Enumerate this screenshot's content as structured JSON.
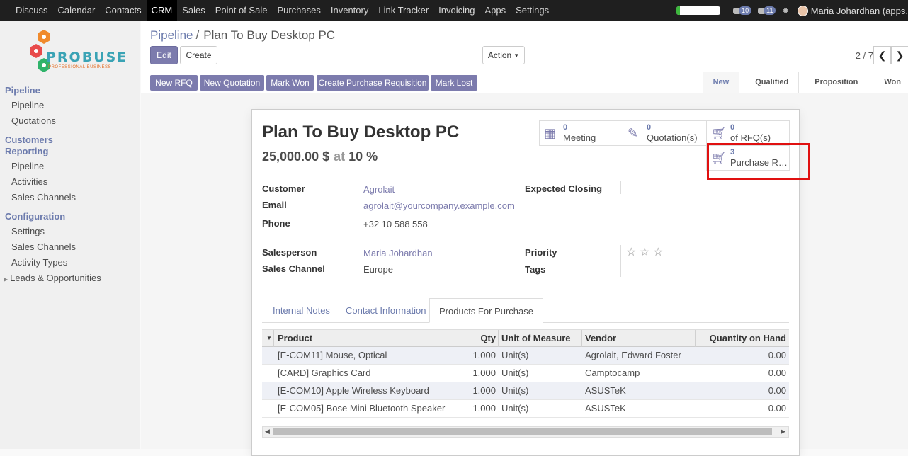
{
  "topbar": {
    "menu": [
      "Discuss",
      "Calendar",
      "Contacts",
      "CRM",
      "Sales",
      "Point of Sale",
      "Purchases",
      "Inventory",
      "Link Tracker",
      "Invoicing",
      "Apps",
      "Settings"
    ],
    "active": "CRM",
    "progress": 0.08,
    "messages_count": "10",
    "chat_count": "11",
    "username": "Maria Johardhan (apps."
  },
  "logo": {
    "brand": "PROBUSE",
    "tagline": "PROFESSIONAL BUSINESS"
  },
  "sidebar": {
    "pipeline_header": "Pipeline",
    "pipeline_items": [
      "Pipeline",
      "Quotations"
    ],
    "customers_header": "Customers",
    "reporting_header": "Reporting",
    "reporting_items": [
      "Pipeline",
      "Activities",
      "Sales Channels"
    ],
    "config_header": "Configuration",
    "config_items": [
      "Settings",
      "Sales Channels",
      "Activity Types"
    ],
    "leads_item": "Leads & Opportunities"
  },
  "breadcrumb": {
    "parent": "Pipeline",
    "separator": "/",
    "current": "Plan To Buy Desktop PC"
  },
  "buttons": {
    "edit": "Edit",
    "create": "Create",
    "action": "Action"
  },
  "pager": {
    "value": "2 / 7"
  },
  "status_buttons": [
    "New RFQ",
    "New Quotation",
    "Mark Won",
    "Create Purchase Requisition",
    "Mark Lost"
  ],
  "stages": [
    "New",
    "Qualified",
    "Proposition",
    "Won"
  ],
  "active_stage": "New",
  "smart_buttons": {
    "meeting": {
      "count": "0",
      "label": "Meeting"
    },
    "quotations": {
      "count": "0",
      "label": "Quotation(s)"
    },
    "rfqs": {
      "count": "0",
      "label": "of RFQ(s)"
    },
    "purchase_req": {
      "count": "3",
      "label": "Purchase Re..."
    }
  },
  "record": {
    "title": "Plan To Buy Desktop PC",
    "revenue": "25,000.00 $",
    "at_label": "at",
    "probability": "10 %"
  },
  "fields": {
    "customer_label": "Customer",
    "customer": "Agrolait",
    "email_label": "Email",
    "email": "agrolait@yourcompany.example.com",
    "phone_label": "Phone",
    "phone": "+32 10 588 558",
    "expected_closing_label": "Expected Closing",
    "expected_closing": "",
    "salesperson_label": "Salesperson",
    "salesperson": "Maria Johardhan",
    "sales_channel_label": "Sales Channel",
    "sales_channel": "Europe",
    "priority_label": "Priority",
    "priority_value": 0,
    "tags_label": "Tags"
  },
  "tabs": [
    "Internal Notes",
    "Contact Information",
    "Products For Purchase"
  ],
  "active_tab": "Products For Purchase",
  "table": {
    "headers": [
      "Product",
      "Qty",
      "Unit of Measure",
      "Vendor",
      "Quantity on Hand"
    ],
    "rows": [
      [
        "[E-COM11] Mouse, Optical",
        "1.000",
        "Unit(s)",
        "Agrolait, Edward Foster",
        "0.00"
      ],
      [
        "[CARD] Graphics Card",
        "1.000",
        "Unit(s)",
        "Camptocamp",
        "0.00"
      ],
      [
        "[E-COM10] Apple Wireless Keyboard",
        "1.000",
        "Unit(s)",
        "ASUSTeK",
        "0.00"
      ],
      [
        "[E-COM05] Bose Mini Bluetooth Speaker",
        "1.000",
        "Unit(s)",
        "ASUSTeK",
        "0.00"
      ]
    ]
  },
  "colors": {
    "accent": "#7c7bad",
    "topbar": "#1f1f1f",
    "highlight": "#e01010"
  }
}
